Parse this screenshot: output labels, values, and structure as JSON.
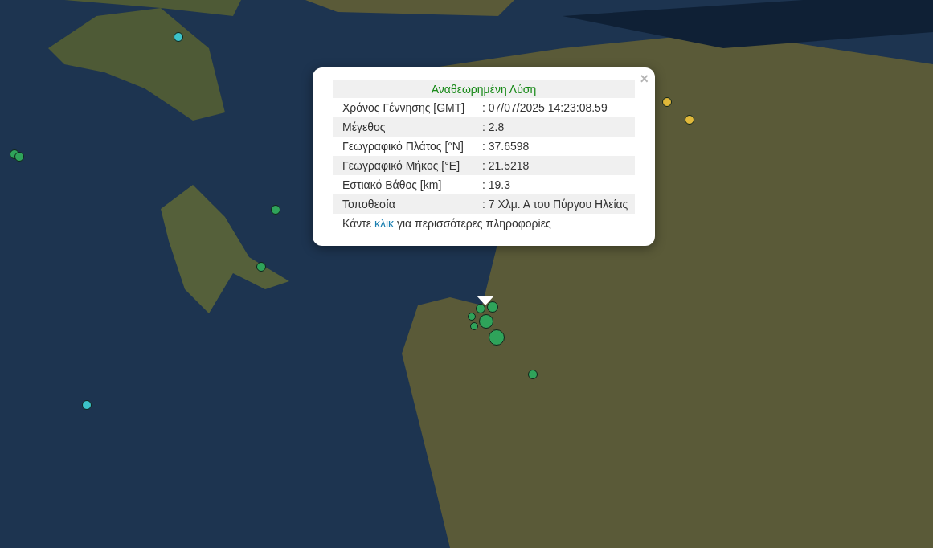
{
  "markers": [
    {
      "color": "#3cc3c9"
    },
    {
      "color": "#2fa35a"
    },
    {
      "color": "#2fa35a"
    },
    {
      "color": "#2fa35a"
    },
    {
      "color": "#2fa35a"
    },
    {
      "color": "#3cc3c9"
    },
    {
      "color": "#e0b83a"
    },
    {
      "color": "#e0b83a"
    },
    {
      "color": "#2fa35a"
    },
    {
      "color": "#2fa35a"
    },
    {
      "color": "#2fa35a"
    },
    {
      "color": "#2fa35a"
    },
    {
      "color": "#2fa35a"
    },
    {
      "color": "#2fa35a"
    },
    {
      "color": "#2fa35a"
    }
  ],
  "popup": {
    "close": "×",
    "title": "Αναθεωρημένη Λύση",
    "rows": [
      {
        "label": "Χρόνος Γέννησης [GMT]",
        "value": ": 07/07/2025 14:23:08.59"
      },
      {
        "label": "Μέγεθος",
        "value": ": 2.8"
      },
      {
        "label": "Γεωγραφικό Πλάτος [°N]",
        "value": ": 37.6598"
      },
      {
        "label": "Γεωγραφικό Μήκος [°E]",
        "value": ": 21.5218"
      },
      {
        "label": "Εστιακό Βάθος [km]",
        "value": ": 19.3"
      },
      {
        "label": "Τοποθεσία",
        "value": ": 7 Χλμ. Α του Πύργου Ηλείας"
      }
    ],
    "footer": {
      "before": "Κάντε",
      "link": "κλικ",
      "after": "για περισσότερες πληροφορίες"
    }
  }
}
